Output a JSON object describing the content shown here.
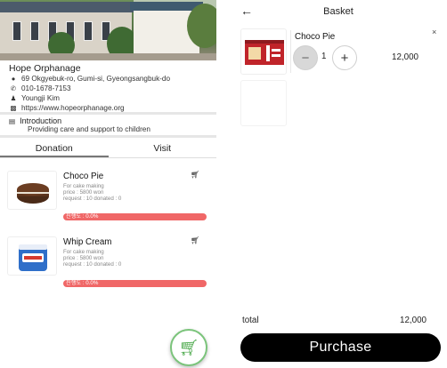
{
  "org": {
    "name": "Hope Orphanage",
    "address": "69 Okgyebuk-ro, Gumi-si, Gyeongsangbuk-do",
    "phone": "010-1678-7153",
    "person": "Youngji Kim",
    "website": "https://www.hopeorphanage.org",
    "icons": {
      "address": "location-icon",
      "phone": "phone-icon",
      "person": "person-icon",
      "website": "computer-icon"
    }
  },
  "intro": {
    "title": "Introduction",
    "text": "Providing care and support to children"
  },
  "tabs": [
    {
      "label": "Donation",
      "active": true
    },
    {
      "label": "Visit",
      "active": false
    }
  ],
  "items": [
    {
      "name": "Choco Pie",
      "purpose": "For cake making",
      "price": "price : 5800 won",
      "request": "request : 10  donated : 0",
      "progress_label": "진행도 : 0.0%",
      "progress": 0.0
    },
    {
      "name": "Whip Cream",
      "purpose": "For cake making",
      "price": "price : 5800 won",
      "request": "request : 10  donated : 0",
      "progress_label": "진행도 : 0.0%",
      "progress": 0.0
    }
  ],
  "basket": {
    "title": "Basket",
    "items": [
      {
        "name": "Choco Pie",
        "qty": "1",
        "price": "12,000"
      }
    ],
    "total_label": "total",
    "total_value": "12,000",
    "purchase_label": "Purchase"
  },
  "colors": {
    "progress_bar": "#f06767",
    "fab_green": "#45a645",
    "purchase_bg": "#000000"
  }
}
